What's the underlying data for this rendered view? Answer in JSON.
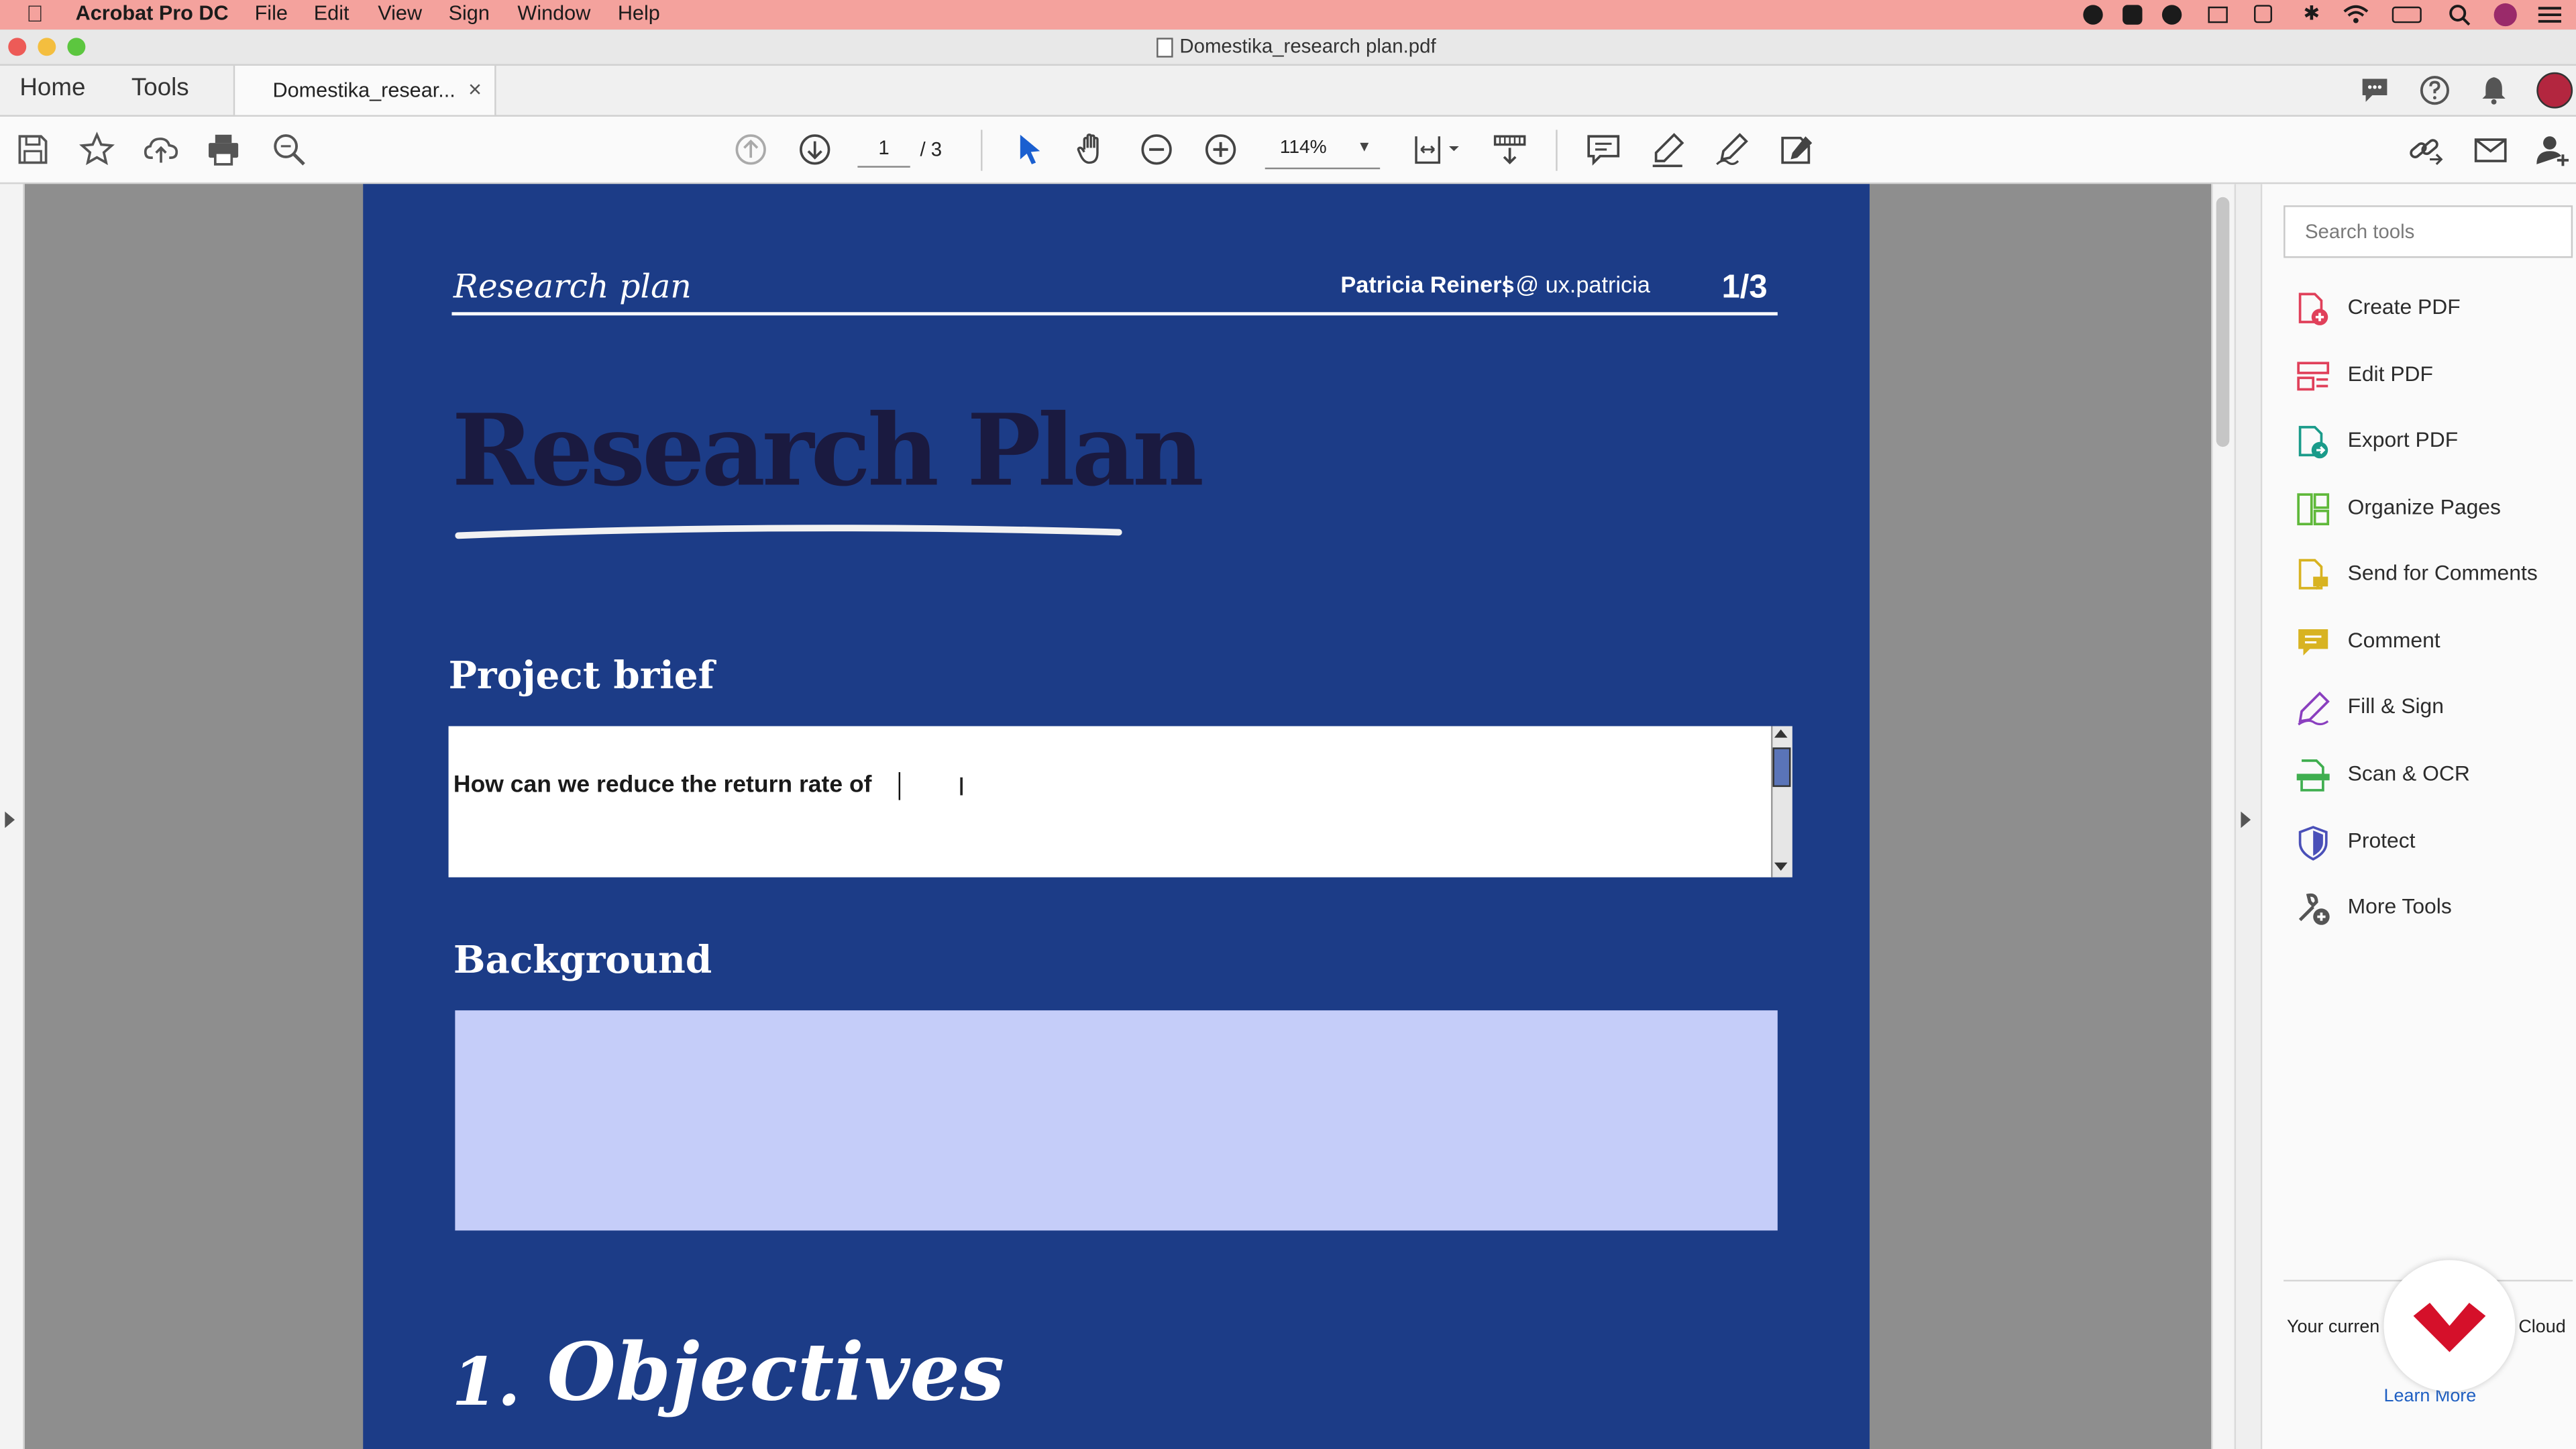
{
  "menubar": {
    "app_name": "Acrobat Pro DC",
    "items": [
      "File",
      "Edit",
      "View",
      "Sign",
      "Window",
      "Help"
    ]
  },
  "window": {
    "title": "Domestika_research plan.pdf"
  },
  "tabs": {
    "home": "Home",
    "tools": "Tools",
    "document": "Domestika_resear...",
    "close": "×"
  },
  "toolbar": {
    "page_current": "1",
    "page_total": "/ 3",
    "zoom": "114%"
  },
  "document": {
    "header_left": "Research plan",
    "author": "Patricia Reiners",
    "handle": " | @ ux.patricia",
    "page_num": "1/3",
    "main_title": "Research Plan",
    "section_brief": "Project brief",
    "brief_text": "How can we reduce the return rate of",
    "section_background": "Background",
    "objectives_num": "1.",
    "objectives_title": "Objectives"
  },
  "tools_pane": {
    "search_placeholder": "Search tools",
    "items": [
      {
        "label": "Create PDF",
        "icon": "create-pdf-icon",
        "color": "#e0405a"
      },
      {
        "label": "Edit PDF",
        "icon": "edit-pdf-icon",
        "color": "#e0405a"
      },
      {
        "label": "Export PDF",
        "icon": "export-pdf-icon",
        "color": "#1a9b8a"
      },
      {
        "label": "Organize Pages",
        "icon": "organize-pages-icon",
        "color": "#5fb83a"
      },
      {
        "label": "Send for Comments",
        "icon": "send-for-comments-icon",
        "color": "#d8b321"
      },
      {
        "label": "Comment",
        "icon": "comment-icon",
        "color": "#d8b321"
      },
      {
        "label": "Fill & Sign",
        "icon": "fill-sign-icon",
        "color": "#8a3fbf"
      },
      {
        "label": "Scan & OCR",
        "icon": "scan-ocr-icon",
        "color": "#3fae4f"
      },
      {
        "label": "Protect",
        "icon": "protect-icon",
        "color": "#4a50b8"
      },
      {
        "label": "More Tools",
        "icon": "more-tools-icon",
        "color": "#555555"
      }
    ],
    "promo_left": "Your curren",
    "promo_right": "Cloud",
    "learn_more": "Learn More"
  },
  "colors": {
    "page_bg": "#1c3c87",
    "title_dark": "#1a1a40",
    "background_box": "#c5cdf9",
    "menubar": "#f4a29d",
    "accent_red": "#d5102a"
  }
}
